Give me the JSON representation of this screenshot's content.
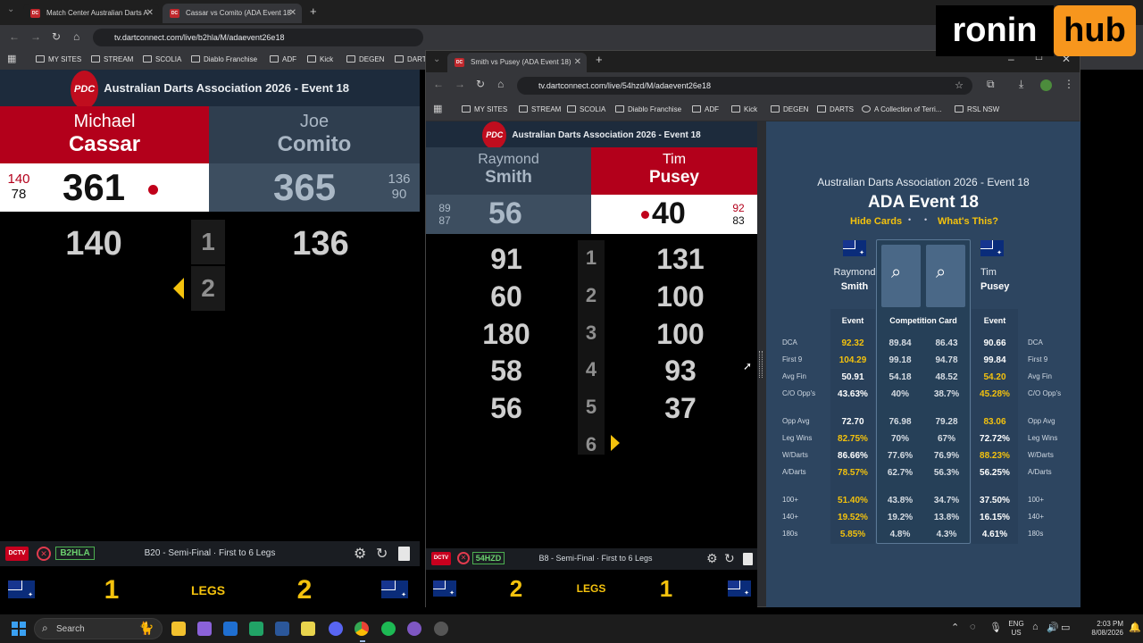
{
  "browser_back": {
    "tabs": [
      {
        "label": "Match Center Australian Darts A"
      },
      {
        "label": "Cassar vs Comito (ADA Event 18"
      }
    ],
    "url": "tv.dartconnect.com/live/b2hla/M/adaevent26e18",
    "bookmarks": [
      "MY SITES",
      "STREAM",
      "SCOLIA",
      "Diablo Franchise",
      "ADF",
      "Kick",
      "DEGEN",
      "DARTS"
    ]
  },
  "left_match": {
    "event_title": "Australian Darts Association 2026 - Event 18",
    "player1": {
      "first": "Michael",
      "last": "Cassar",
      "score": "361",
      "last_throw": "140",
      "darts_sub": "78"
    },
    "player2": {
      "first": "Joe",
      "last": "Comito",
      "score": "365",
      "last_throw": "136",
      "darts_sub": "90"
    },
    "rows": [
      {
        "leg": "1",
        "p1": "140",
        "p2": "136"
      },
      {
        "leg": "2",
        "p1": "",
        "p2": ""
      }
    ],
    "footer": {
      "dctv": "DCTV",
      "code": "B2HLA",
      "round": "B20 - Semi-Final · First to 6 Legs"
    },
    "legs": {
      "p1": "1",
      "label": "LEGS",
      "p2": "2"
    }
  },
  "browser_front": {
    "tab": "Smith vs Pusey (ADA Event 18)",
    "url": "tv.dartconnect.com/live/54hzd/M/adaevent26e18",
    "bookmarks": [
      "MY SITES",
      "STREAM",
      "SCOLIA",
      "Diablo Franchise",
      "ADF",
      "Kick",
      "DEGEN",
      "DARTS",
      "A Collection of Terri...",
      "RSL NSW"
    ]
  },
  "right_match": {
    "event_title": "Australian Darts Association 2026 - Event 18",
    "player1": {
      "first": "Raymond",
      "last": "Smith",
      "score": "56",
      "last_throw": "89",
      "darts_sub": "87"
    },
    "player2": {
      "first": "Tim",
      "last": "Pusey",
      "score": "40",
      "last_throw": "92",
      "darts_sub": "83"
    },
    "rows": [
      {
        "leg": "1",
        "p1": "91",
        "p2": "131"
      },
      {
        "leg": "2",
        "p1": "60",
        "p2": "100"
      },
      {
        "leg": "3",
        "p1": "180",
        "p2": "100"
      },
      {
        "leg": "4",
        "p1": "58",
        "p2": "93"
      },
      {
        "leg": "5",
        "p1": "56",
        "p2": "37"
      },
      {
        "leg": "6",
        "p1": "",
        "p2": ""
      }
    ],
    "footer": {
      "dctv": "DCTV",
      "code": "54HZD",
      "round": "B8 - Semi-Final · First to 6 Legs"
    },
    "legs": {
      "p1": "2",
      "label": "LEGS",
      "p2": "1"
    }
  },
  "stats_panel": {
    "title": "Australian Darts Association 2026 - Event 18",
    "subtitle": "ADA Event 18",
    "hide_cards": "Hide Cards",
    "whats_this": "What's This?",
    "p1_first": "Raymond",
    "p1_last": "Smith",
    "p2_first": "Tim",
    "p2_last": "Pusey",
    "hdr_event": "Event",
    "hdr_comp": "Competition Card",
    "rows": [
      {
        "label": "DCA",
        "p1_event": "92.32",
        "p1_comp": "89.84",
        "p2_comp": "86.43",
        "p2_event": "90.66",
        "p1_y": true,
        "p2_y": false
      },
      {
        "label": "First 9",
        "p1_event": "104.29",
        "p1_comp": "99.18",
        "p2_comp": "94.78",
        "p2_event": "99.84",
        "p1_y": true,
        "p2_y": false
      },
      {
        "label": "Avg Fin",
        "p1_event": "50.91",
        "p1_comp": "54.18",
        "p2_comp": "48.52",
        "p2_event": "54.20",
        "p1_y": false,
        "p2_y": true
      },
      {
        "label": "C/O Opp's",
        "p1_event": "43.63%",
        "p1_comp": "40%",
        "p2_comp": "38.7%",
        "p2_event": "45.28%",
        "p1_y": false,
        "p2_y": true
      },
      {
        "label": "Opp Avg",
        "p1_event": "72.70",
        "p1_comp": "76.98",
        "p2_comp": "79.28",
        "p2_event": "83.06",
        "p1_y": false,
        "p2_y": true
      },
      {
        "label": "Leg Wins",
        "p1_event": "82.75%",
        "p1_comp": "70%",
        "p2_comp": "67%",
        "p2_event": "72.72%",
        "p1_y": true,
        "p2_y": false
      },
      {
        "label": "W/Darts",
        "p1_event": "86.66%",
        "p1_comp": "77.6%",
        "p2_comp": "76.9%",
        "p2_event": "88.23%",
        "p1_y": false,
        "p2_y": true
      },
      {
        "label": "A/Darts",
        "p1_event": "78.57%",
        "p1_comp": "62.7%",
        "p2_comp": "56.3%",
        "p2_event": "56.25%",
        "p1_y": true,
        "p2_y": false
      },
      {
        "label": "100+",
        "p1_event": "51.40%",
        "p1_comp": "43.8%",
        "p2_comp": "34.7%",
        "p2_event": "37.50%",
        "p1_y": true,
        "p2_y": false
      },
      {
        "label": "140+",
        "p1_event": "19.52%",
        "p1_comp": "19.2%",
        "p2_comp": "13.8%",
        "p2_event": "16.15%",
        "p1_y": true,
        "p2_y": false
      },
      {
        "label": "180s",
        "p1_event": "5.85%",
        "p1_comp": "4.8%",
        "p2_comp": "4.3%",
        "p2_event": "4.61%",
        "p1_y": true,
        "p2_y": false
      }
    ]
  },
  "watermark": {
    "part1": "ronin",
    "part2": "hub"
  },
  "taskbar": {
    "search": "Search",
    "lang1": "ENG",
    "lang2": "US",
    "time": "2:03 PM",
    "date": "8/08/2026"
  },
  "colors": {
    "red": "#b3001b",
    "slate": "#2f3e4f",
    "yellow": "#f4c20d",
    "stats_bg": "#2d4560"
  }
}
